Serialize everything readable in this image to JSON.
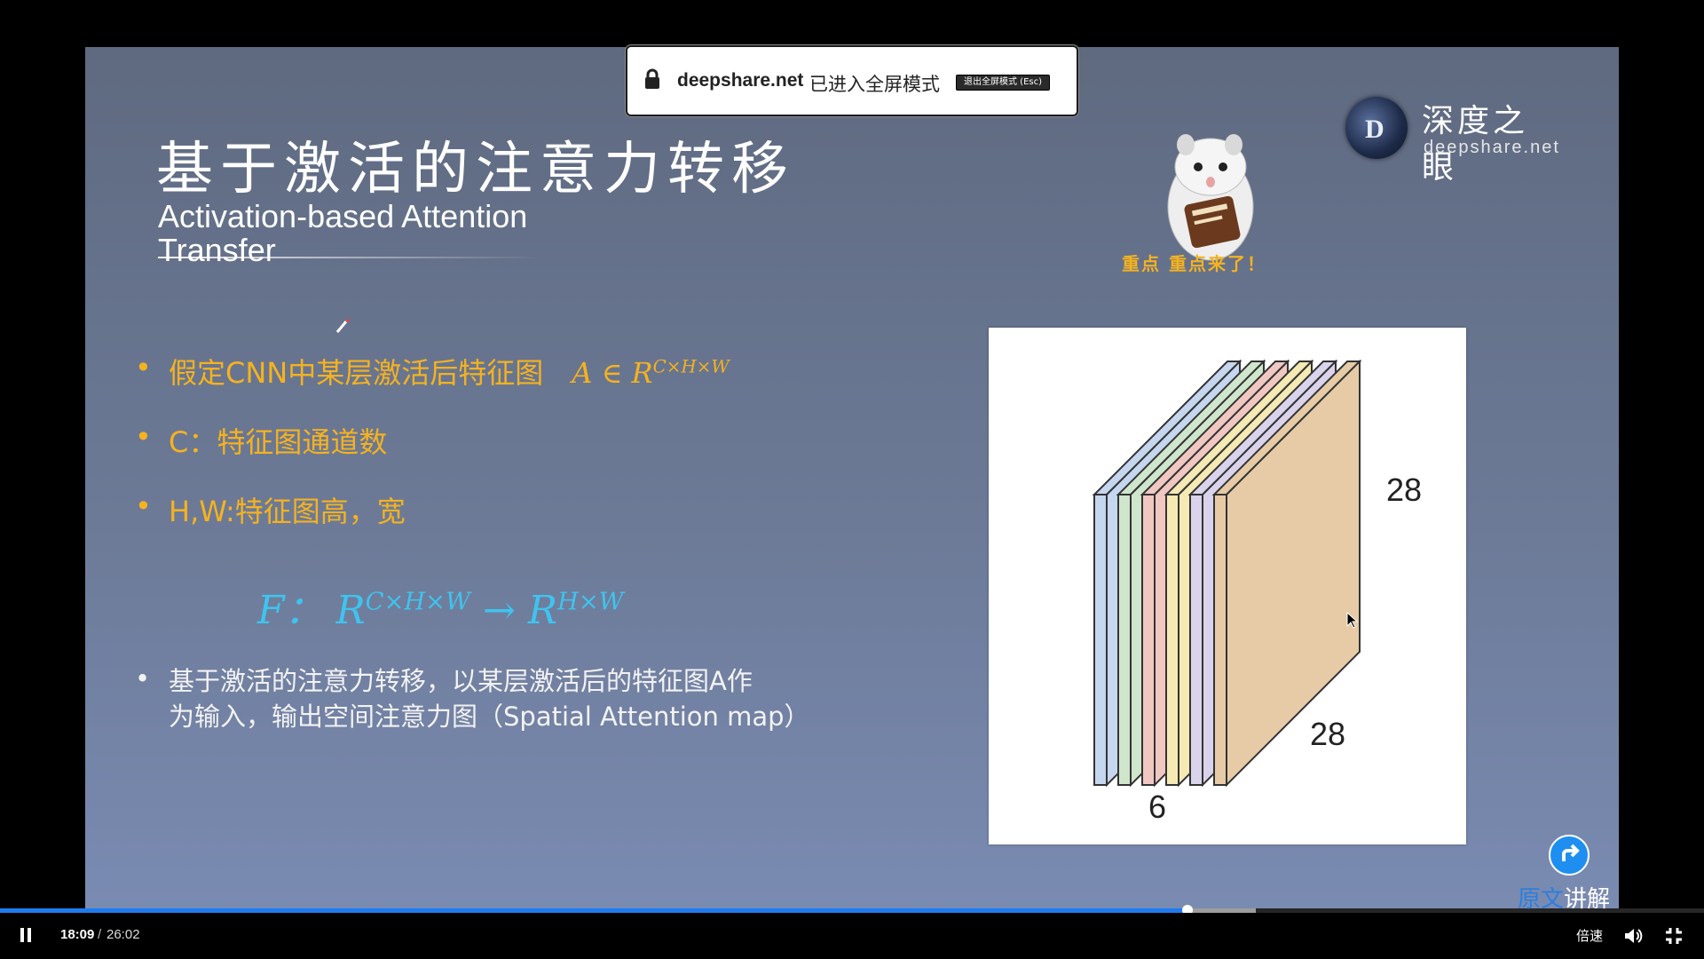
{
  "fullscreen_notice": {
    "host": "deepshare.net",
    "message": "已进入全屏模式",
    "exit_button": "退出全屏模式 (Esc)"
  },
  "slide": {
    "title_cn": "基于激活的注意力转移",
    "title_en": "Activation-based Attention Transfer",
    "logo": {
      "name": "深度之眼",
      "url": "deepshare.net",
      "letter": "D"
    },
    "mascot_caption": "重点  重点来了！",
    "bullets": [
      {
        "text": "假定CNN中某层激活后特征图",
        "math": "A ∈ R",
        "sup": "C×H×W",
        "color": "#f5b21f"
      },
      {
        "text": "C：特征图通道数",
        "color": "#f5b21f"
      },
      {
        "text": "H,W:特征图高，宽",
        "color": "#f5b21f"
      },
      {
        "text_line1": "基于激活的注意力转移，以某层激活后的特征图A作",
        "text_line2": "为输入，输出空间注意力图（Spatial  Attention  map）",
        "color": "#f2f2f2"
      }
    ],
    "formula": {
      "lhs": "F：",
      "r1": "R",
      "sup1": "C×H×W",
      "arrow": "→",
      "r2": "R",
      "sup2": "H×W",
      "color": "#3ec4ef"
    },
    "figure": {
      "label_height": "28",
      "label_width": "28",
      "label_channels": "6",
      "layer_colors": [
        "#c5d6ef",
        "#cfe6cc",
        "#f1c7c2",
        "#f5e9b4",
        "#d9d3ec",
        "#e6cba6"
      ]
    }
  },
  "action": {
    "label_highlight": "原文",
    "label_rest": "讲解"
  },
  "player": {
    "current_time": "18:09",
    "separator": "/",
    "total_time": "26:02",
    "progress": 0.697,
    "buffered": 0.737,
    "speed_label": "倍速"
  }
}
